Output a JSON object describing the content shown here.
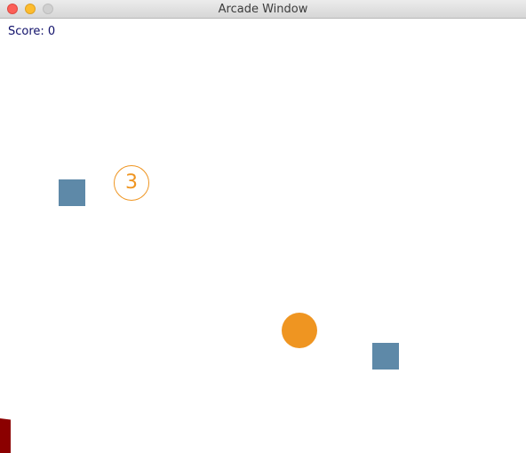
{
  "window": {
    "title": "Arcade Window"
  },
  "hud": {
    "score_text": "Score: 0"
  },
  "game": {
    "countdown": "3",
    "colors": {
      "background": "#ffffff",
      "score_text": "#10106a",
      "block": "#5e89a8",
      "ball": "#ef9521",
      "countdown": "#ef9521",
      "paddle": "#8b0000"
    }
  }
}
